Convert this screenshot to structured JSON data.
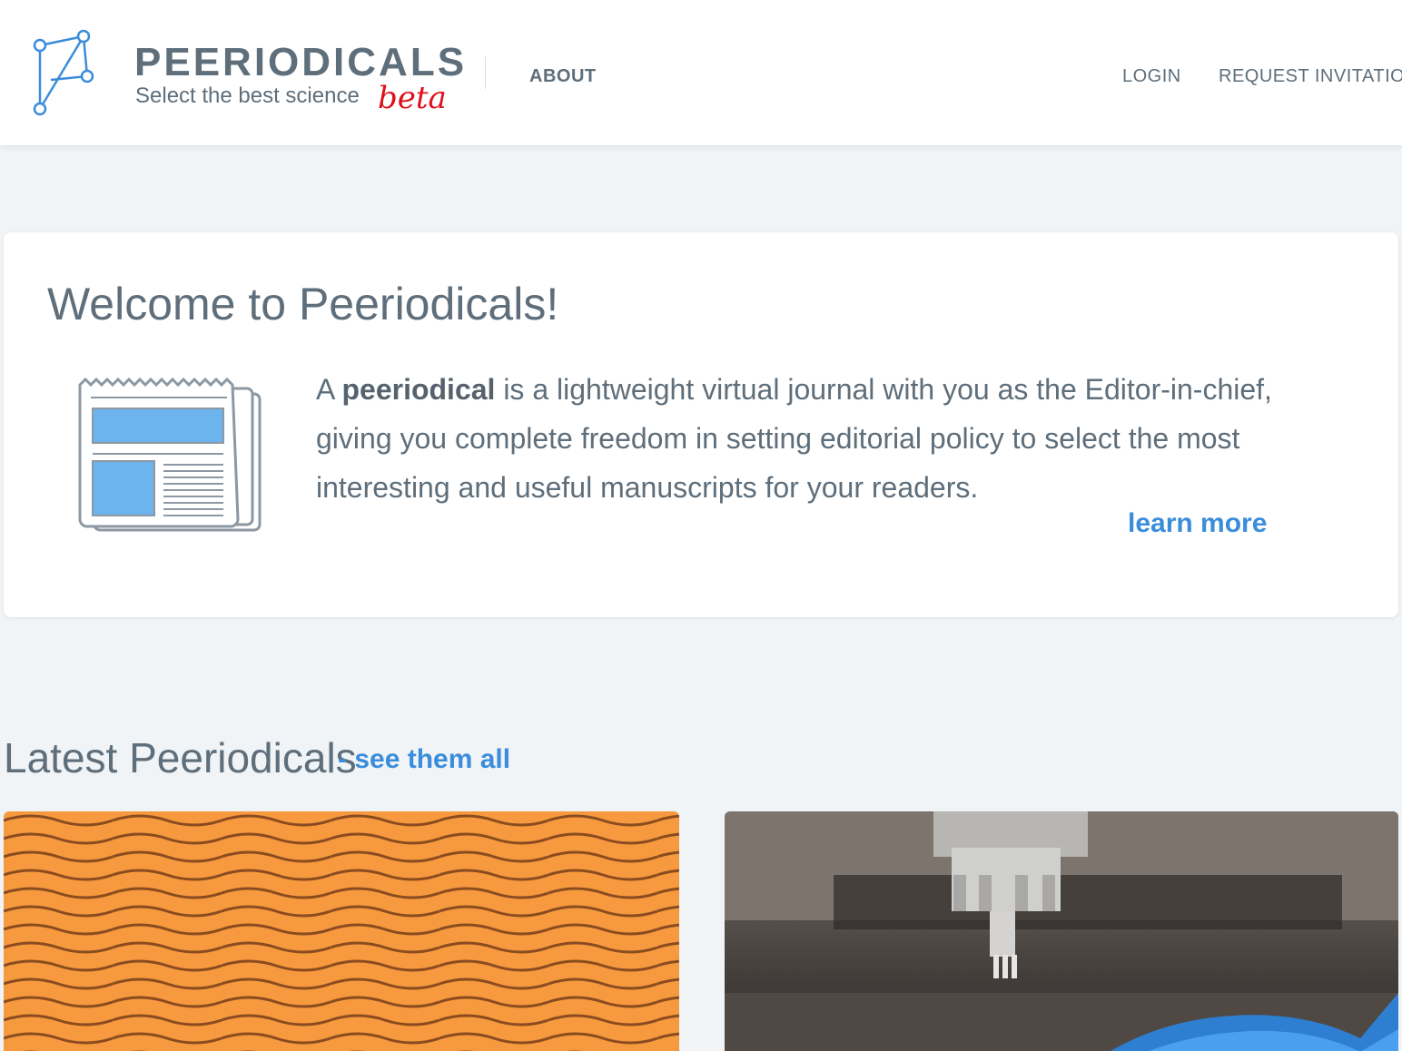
{
  "header": {
    "brand_title": "PEERIODICALS",
    "brand_subtitle": "Select the best science",
    "brand_tag": "beta",
    "nav_about": "ABOUT",
    "nav_login": "LOGIN",
    "nav_request": "REQUEST INVITATION"
  },
  "welcome": {
    "title": "Welcome to Peeriodicals!",
    "text_prefix": "A ",
    "text_bold": "peeriodical",
    "text_rest": " is a lightweight virtual journal with you as the Editor-in-chief, giving you complete freedom in setting editorial policy to select the most interesting and useful manuscripts for your readers.",
    "learn_more": "learn more"
  },
  "latest": {
    "title": "Latest Peeriodicals",
    "see_all": "- see them all"
  },
  "colors": {
    "accent": "#3b8ddb",
    "beta": "#e0101a",
    "orange_card": "#f7993e",
    "page_bg": "#f0f4f7"
  },
  "icons": {
    "logo": "peeriodicals-logo-icon",
    "newspaper": "newspaper-icon"
  }
}
